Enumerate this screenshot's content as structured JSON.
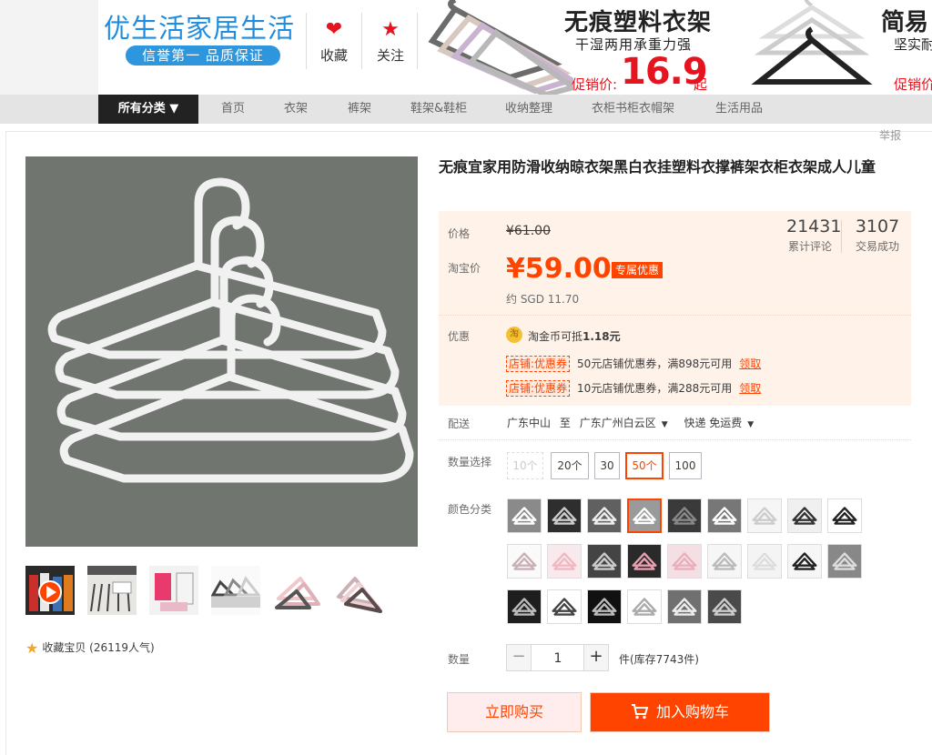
{
  "banner": {
    "shop_name": "优生活家居生活",
    "slogan": "信誉第一 品质保证",
    "favorite_label": "收藏",
    "follow_label": "关注",
    "promo1_title": "无痕塑料衣架",
    "promo1_sub": "干湿两用承重力强",
    "promo1_price_label": "促销价:",
    "promo1_price": "16.9",
    "promo1_price_unit": "起",
    "promo2_title": "简易",
    "promo2_sub": "坚实耐",
    "promo2_label": "促销价"
  },
  "nav": {
    "all_categories": "所有分类 ▼",
    "items": [
      "首页",
      "衣架",
      "裤架",
      "鞋架&鞋柜",
      "收纳整理",
      "衣柜书柜衣帽架",
      "生活用品"
    ]
  },
  "report_label": "举报",
  "product": {
    "title": "无痕宜家用防滑收纳晾衣架黑白衣挂塑料衣撑裤架衣柜衣架成人儿童",
    "favorite_text": "收藏宝贝 (26119人气)"
  },
  "price": {
    "label": "价格",
    "original": "¥61.00",
    "taobao_label": "淘宝价",
    "current": "¥59.00",
    "badge": "专属优惠",
    "sgd": "约 SGD 11.70",
    "reviews_count": "21431",
    "reviews_label": "累计评论",
    "deals_count": "3107",
    "deals_label": "交易成功"
  },
  "promotion": {
    "label": "优惠",
    "coin_icon_text": "淘",
    "coin_text": "淘金币可抵",
    "coin_amount": "1.18元",
    "coupons": [
      {
        "tag": "店铺:优惠券",
        "desc": "50元店铺优惠券，满898元可用",
        "action": "领取"
      },
      {
        "tag": "店铺:优惠券",
        "desc": "10元店铺优惠券，满288元可用",
        "action": "领取"
      }
    ]
  },
  "delivery": {
    "label": "配送",
    "from": "广东中山",
    "to_word": "至",
    "to": "广东广州白云区",
    "shipping": "快递 免运费"
  },
  "quantity_select": {
    "label": "数量选择",
    "options": [
      "10个",
      "20个",
      "30",
      "50个",
      "100"
    ],
    "selected_index": 3
  },
  "colors": {
    "label": "颜色分类",
    "selected_index": 3,
    "swatch_count": 24
  },
  "quantity": {
    "label": "数量",
    "minus": "−",
    "value": "1",
    "plus": "+",
    "stock": "件(库存7743件)"
  },
  "actions": {
    "buy_now": "立即购买",
    "add_to_cart": "加入购物车"
  },
  "colors_theme": {
    "accent": "#ff4400",
    "price_bg": "#fff2e8",
    "banner_blue": "#1f8ce0"
  }
}
